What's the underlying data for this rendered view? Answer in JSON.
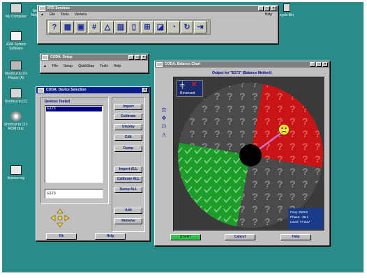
{
  "desktop": {
    "icons": [
      {
        "label": "My Computer"
      },
      {
        "label": "Netwo Neighbo"
      },
      {
        "label": "A2M System Software"
      },
      {
        "label": "Shortcut to 3½ Floppy (A)"
      },
      {
        "label": "Shortcut to (C)"
      },
      {
        "label": "Shortcut to CD-ROM Disc"
      },
      {
        "label": "license.reg"
      },
      {
        "label": "cycle Bin"
      }
    ]
  },
  "rts_window": {
    "title": "RTS Services",
    "menus": [
      "File",
      "Tools",
      "Viewers"
    ],
    "help": "Help"
  },
  "setup_window": {
    "title": "CODA: Setup",
    "menus": [
      "File",
      "Setup",
      "QuickStep",
      "Tools",
      "Help"
    ]
  },
  "device_window": {
    "title": "CODA: Device Selection",
    "devices_label": "Devices Tested",
    "devices": [
      "E173"
    ],
    "current_device": "E173",
    "buttons": {
      "import": "Import",
      "calibrate": "Calibrate",
      "display": "Display",
      "edit": "Edit",
      "dump": "Dump",
      "import_all": "Import ALL",
      "calibrate_all": "Calibrate ALL",
      "dump_all": "Dump ALL",
      "add": "Add",
      "remove": "Remove",
      "ok": "Ok",
      "help": "Help"
    }
  },
  "balance_window": {
    "title": "CODA: Balance Chart",
    "output_label": "Output for \"E173\" (Balance Method)",
    "reversed_label": "Reversed",
    "side_letters": [
      "D",
      "A"
    ],
    "freq": "Freq: 250Hz",
    "phase": "Phase: -38.1",
    "level": "Level: 77.6uV",
    "buttons": {
      "start": "START",
      "cancel": "Cancel",
      "help": "Help"
    },
    "colors": {
      "red_sector": "#c81414",
      "green_sector": "#1e9c2a",
      "gray_sector": "#4a4a4a"
    }
  }
}
